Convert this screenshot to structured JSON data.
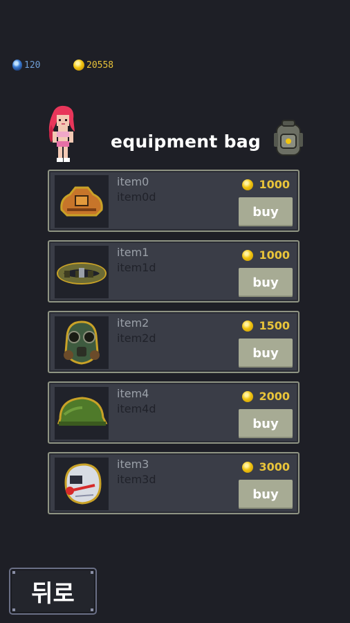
{
  "currency": {
    "gems": "120",
    "gold": "20558"
  },
  "header": {
    "title": "equipment bag"
  },
  "icons": {
    "gem": "blue-gem-icon",
    "gold": "gold-coin-icon",
    "bag": "backpack-icon"
  },
  "items": [
    {
      "name": "item0",
      "desc": "item0d",
      "price": "1000",
      "buy_label": "buy",
      "icon": "armor-vest-icon",
      "color": "#c7752a"
    },
    {
      "name": "item1",
      "desc": "item1d",
      "price": "1000",
      "buy_label": "buy",
      "icon": "belt-icon",
      "color": "#6c6b34"
    },
    {
      "name": "item2",
      "desc": "item2d",
      "price": "1500",
      "buy_label": "buy",
      "icon": "gas-mask-icon",
      "color": "#3e5b3f"
    },
    {
      "name": "item4",
      "desc": "item4d",
      "price": "2000",
      "buy_label": "buy",
      "icon": "helmet-icon",
      "color": "#4f7a2a"
    },
    {
      "name": "item3",
      "desc": "item3d",
      "price": "3000",
      "buy_label": "buy",
      "icon": "space-helmet-icon",
      "color": "#d8dce3"
    }
  ],
  "back_button": {
    "label": "뒤로"
  }
}
